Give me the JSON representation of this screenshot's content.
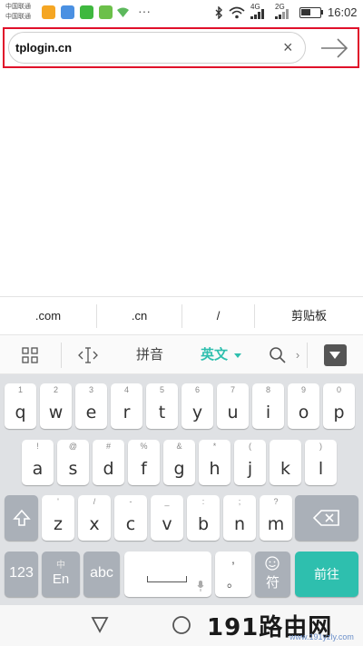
{
  "status_bar": {
    "carrier_1": "中国联通",
    "carrier_2": "中国联通",
    "network_1": "4G",
    "network_2": "2G",
    "battery_level": 0.5,
    "time": "16:02",
    "app_icons": [
      "email-icon",
      "gallery-icon",
      "wechat-icon",
      "sms-icon",
      "wifi-app-icon",
      "more-dots-icon"
    ]
  },
  "browser": {
    "url": "tplogin.cn",
    "clear_icon": "×"
  },
  "suggestions": [
    ".com",
    ".cn",
    "/",
    "剪贴板"
  ],
  "ime_toolbar": {
    "layout_icon": "grid-icon",
    "cursor_icon": "cursor-icon",
    "pinyin": "拼音",
    "english": "英文",
    "search_icon": "search-icon",
    "more": "›"
  },
  "keyboard": {
    "row1": [
      {
        "hint": "1",
        "key": "q"
      },
      {
        "hint": "2",
        "key": "w"
      },
      {
        "hint": "3",
        "key": "e"
      },
      {
        "hint": "4",
        "key": "r"
      },
      {
        "hint": "5",
        "key": "t"
      },
      {
        "hint": "6",
        "key": "y"
      },
      {
        "hint": "7",
        "key": "u"
      },
      {
        "hint": "8",
        "key": "i"
      },
      {
        "hint": "9",
        "key": "o"
      },
      {
        "hint": "0",
        "key": "p"
      }
    ],
    "row2": [
      {
        "hint": "!",
        "key": "a"
      },
      {
        "hint": "@",
        "key": "s"
      },
      {
        "hint": "#",
        "key": "d"
      },
      {
        "hint": "%",
        "key": "f"
      },
      {
        "hint": "&",
        "key": "g"
      },
      {
        "hint": "*",
        "key": "h"
      },
      {
        "hint": "(",
        "key": "j"
      },
      {
        "hint": "",
        "key": "k"
      },
      {
        "hint": ")",
        "key": "l"
      }
    ],
    "row3": [
      {
        "hint": "'",
        "key": "z"
      },
      {
        "hint": "/",
        "key": "x"
      },
      {
        "hint": "-",
        "key": "c"
      },
      {
        "hint": "_",
        "key": "v"
      },
      {
        "hint": ":",
        "key": "b"
      },
      {
        "hint": ";",
        "key": "n"
      },
      {
        "hint": "?",
        "key": "m"
      }
    ],
    "num_key": "123",
    "lang_key_top": "中",
    "lang_key_bottom": "En",
    "abc_key": "abc",
    "comma_top": ",",
    "period_bottom": "。",
    "symbol_key": "符",
    "go_key": "前往"
  },
  "watermark": {
    "text": "191路由网",
    "sub": "www.191yzly.com"
  },
  "colors": {
    "highlight_frame": "#e0102a",
    "accent_teal": "#2ebfae",
    "keyboard_bg": "#dfe1e4"
  }
}
